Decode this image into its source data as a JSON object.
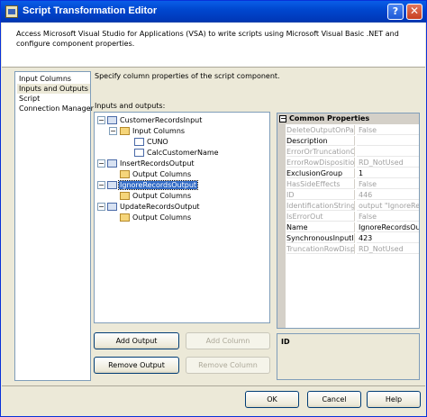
{
  "window": {
    "title": "Script Transformation Editor"
  },
  "titlebar": {
    "help_glyph": "?",
    "close_glyph": "✕"
  },
  "header": {
    "description": "Access Microsoft Visual Studio for Applications (VSA) to write scripts using Microsoft Visual Basic .NET and configure component properties."
  },
  "nav": {
    "items": [
      "Input Columns",
      "Inputs and Outputs",
      "Script",
      "Connection Manager"
    ],
    "selected": "Inputs and Outputs"
  },
  "content": {
    "description": "Specify column properties of the script component.",
    "io_label": "Inputs and outputs:"
  },
  "tree": {
    "nodes": [
      {
        "label": "CustomerRecordsInput",
        "expander": "−"
      },
      {
        "label": "Input Columns",
        "expander": "−"
      },
      {
        "label": "CUNO"
      },
      {
        "label": "CalcCustomerName"
      },
      {
        "label": "InsertRecordsOutput",
        "expander": "−"
      },
      {
        "label": "Output Columns"
      },
      {
        "label": "IgnoreRecordsOutput",
        "expander": "−"
      },
      {
        "label": "Output Columns"
      },
      {
        "label": "UpdateRecordsOutput",
        "expander": "−"
      },
      {
        "label": "Output Columns"
      }
    ]
  },
  "properties": {
    "header": "Common Properties",
    "header_expander": "−",
    "rows": [
      {
        "name": "DeleteOutputOnPath",
        "value": "False",
        "disabled": true
      },
      {
        "name": "Description",
        "value": "",
        "disabled": false
      },
      {
        "name": "ErrorOrTruncationOp",
        "value": "",
        "disabled": true
      },
      {
        "name": "ErrorRowDisposition",
        "value": "RD_NotUsed",
        "disabled": true
      },
      {
        "name": "ExclusionGroup",
        "value": "1",
        "disabled": false
      },
      {
        "name": "HasSideEffects",
        "value": "False",
        "disabled": true
      },
      {
        "name": "ID",
        "value": "446",
        "disabled": true
      },
      {
        "name": "IdentificationString",
        "value": "output \"IgnoreRe",
        "disabled": true
      },
      {
        "name": "IsErrorOut",
        "value": "False",
        "disabled": true
      },
      {
        "name": "Name",
        "value": "IgnoreRecordsOut",
        "disabled": false
      },
      {
        "name": "SynchronousInputID",
        "value": "423",
        "disabled": false
      },
      {
        "name": "TruncationRowDispo",
        "value": "RD_NotUsed",
        "disabled": true
      }
    ],
    "description_title": "ID"
  },
  "buttons": {
    "add_output": "Add Output",
    "add_column": "Add Column",
    "remove_output": "Remove Output",
    "remove_column": "Remove Column",
    "ok": "OK",
    "cancel": "Cancel",
    "help": "Help"
  }
}
